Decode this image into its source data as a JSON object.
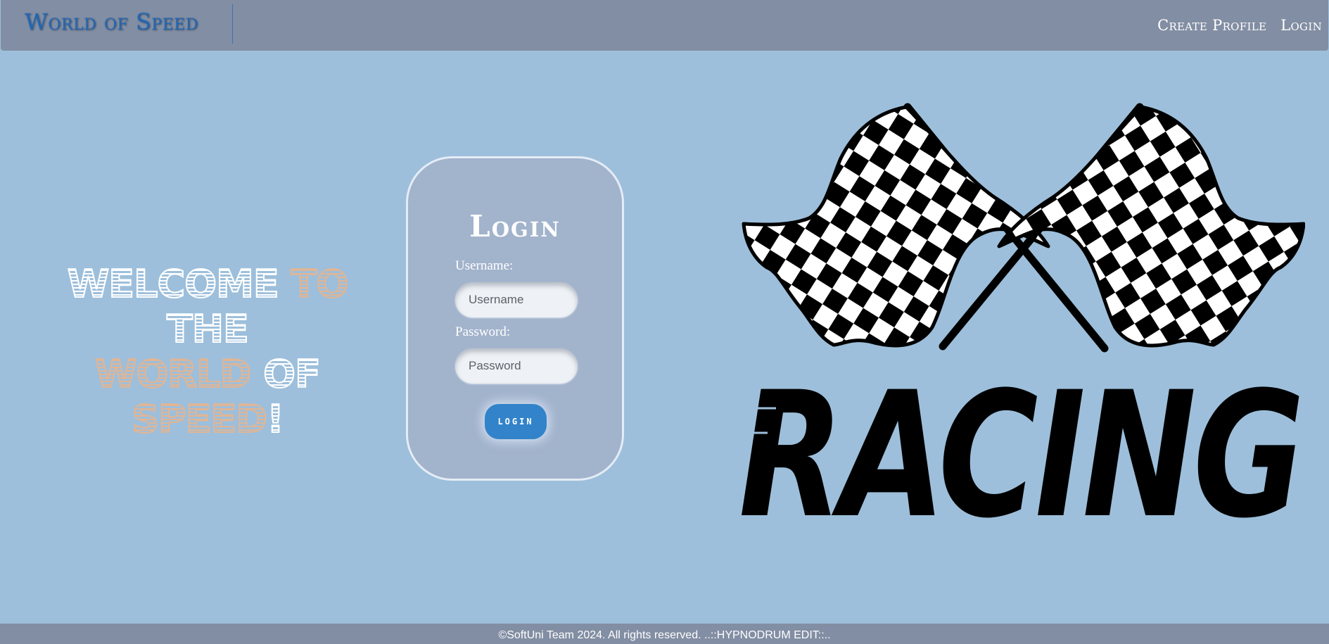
{
  "header": {
    "brand": "World of Speed",
    "nav": [
      {
        "label": "Create Profile"
      },
      {
        "label": "Login"
      }
    ]
  },
  "welcome": {
    "line1": [
      {
        "text": "WELCOME",
        "style": "white"
      },
      {
        "text": " TO ",
        "style": "peach"
      },
      {
        "text": "THE",
        "style": "white"
      }
    ],
    "line2": [
      {
        "text": "WORLD ",
        "style": "peach"
      },
      {
        "text": "OF",
        "style": "white"
      }
    ],
    "line3": [
      {
        "text": "SPEED",
        "style": "peach"
      },
      {
        "text": "!",
        "style": "white"
      }
    ]
  },
  "login": {
    "title": "Login",
    "username_label": "Username:",
    "username_placeholder": "Username",
    "password_label": "Password:",
    "password_placeholder": "Password",
    "button_label": "LOGIN"
  },
  "logo": {
    "icon": "checkered-flags-racing-logo",
    "wordmark": "RACING"
  },
  "footer": {
    "text": "©SoftUni Team 2024. All rights reserved. ..::HYPNODRUM EDIT::.."
  },
  "colors": {
    "background": "#9dbfdb",
    "header_footer": "#828ea3",
    "brand": "#1f67b7",
    "card": "#a2b3cc",
    "button": "#3283c9",
    "accent_peach": "#e0b595"
  }
}
